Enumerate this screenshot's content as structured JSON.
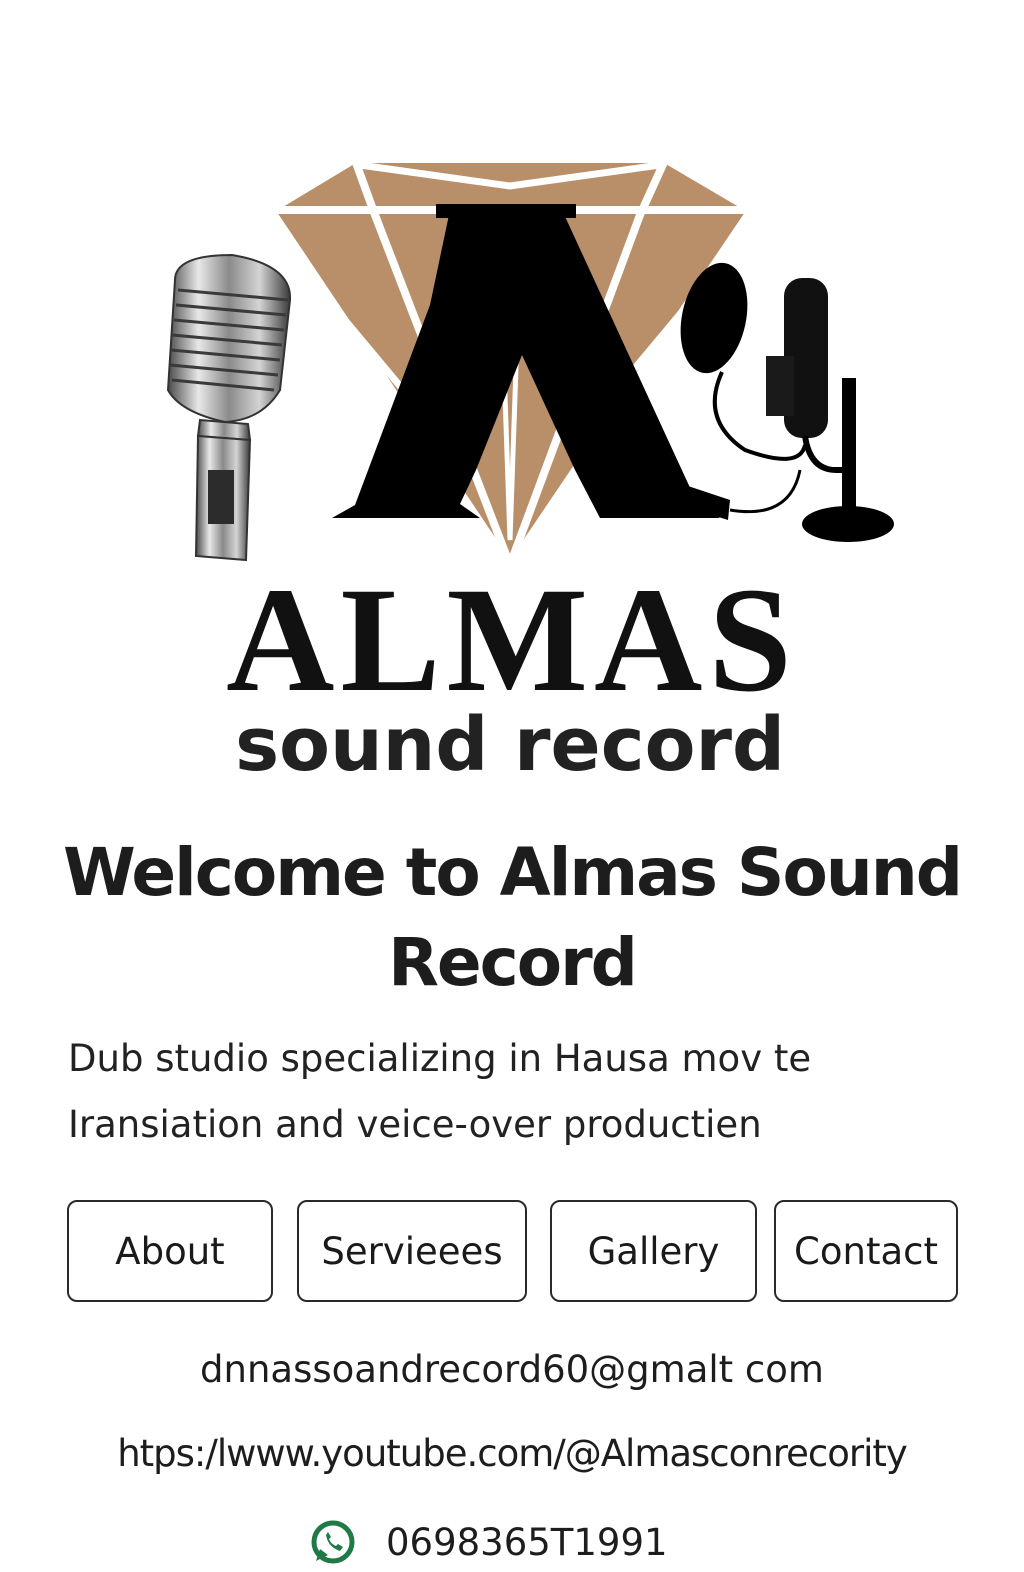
{
  "brand": {
    "logo_name": "ALMAS",
    "logo_subtitle": "sound record",
    "accent_color": "#b88f68",
    "logo_icons": [
      "diamond-icon",
      "vintage-microphone-icon",
      "studio-microphone-icon"
    ]
  },
  "hero": {
    "title": "Welcome to Almas Sound Record",
    "tagline": "Dub studio specializing in Hausa mov te Iransiation and veice-over productien"
  },
  "nav": {
    "items": [
      "About",
      "Servieees",
      "Gallery",
      "Contact"
    ]
  },
  "contact": {
    "email": "dnnassoandrecord60@gmalt com",
    "youtube": "htps:/lwww.youtube.com/@Almasconrecority",
    "phone": "0698365T1991",
    "phone_icon": "whatsapp-icon",
    "phone_icon_color": "#1f7a45"
  }
}
